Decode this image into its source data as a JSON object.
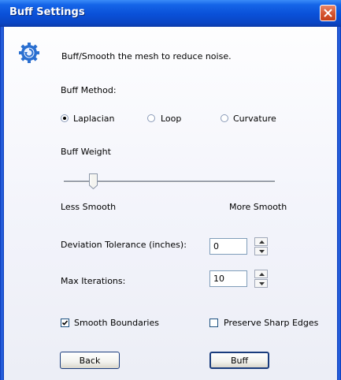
{
  "window": {
    "title": "Buff Settings"
  },
  "icons": {
    "close": "close-icon",
    "gear": "gear-icon"
  },
  "header": {
    "description": "Buff/Smooth the mesh to reduce noise."
  },
  "method": {
    "label": "Buff Method:",
    "options": [
      {
        "label": "Laplacian",
        "selected": true
      },
      {
        "label": "Loop",
        "selected": false
      },
      {
        "label": "Curvature",
        "selected": false
      }
    ]
  },
  "weight": {
    "label": "Buff Weight",
    "min_label": "Less Smooth",
    "max_label": "More Smooth",
    "value_fraction": 0.14
  },
  "tolerance": {
    "label": "Deviation Tolerance (inches):",
    "value": "0"
  },
  "iterations": {
    "label": "Max Iterations:",
    "value": "10"
  },
  "options": {
    "smooth_boundaries": {
      "label": "Smooth Boundaries",
      "checked": true
    },
    "preserve_edges": {
      "label": "Preserve Sharp Edges",
      "checked": false
    }
  },
  "buttons": {
    "back": "Back",
    "buff": "Buff"
  },
  "colors": {
    "title_bar": "#0a50d8",
    "close_button": "#d5542e",
    "gear": "#2a6fd0"
  }
}
